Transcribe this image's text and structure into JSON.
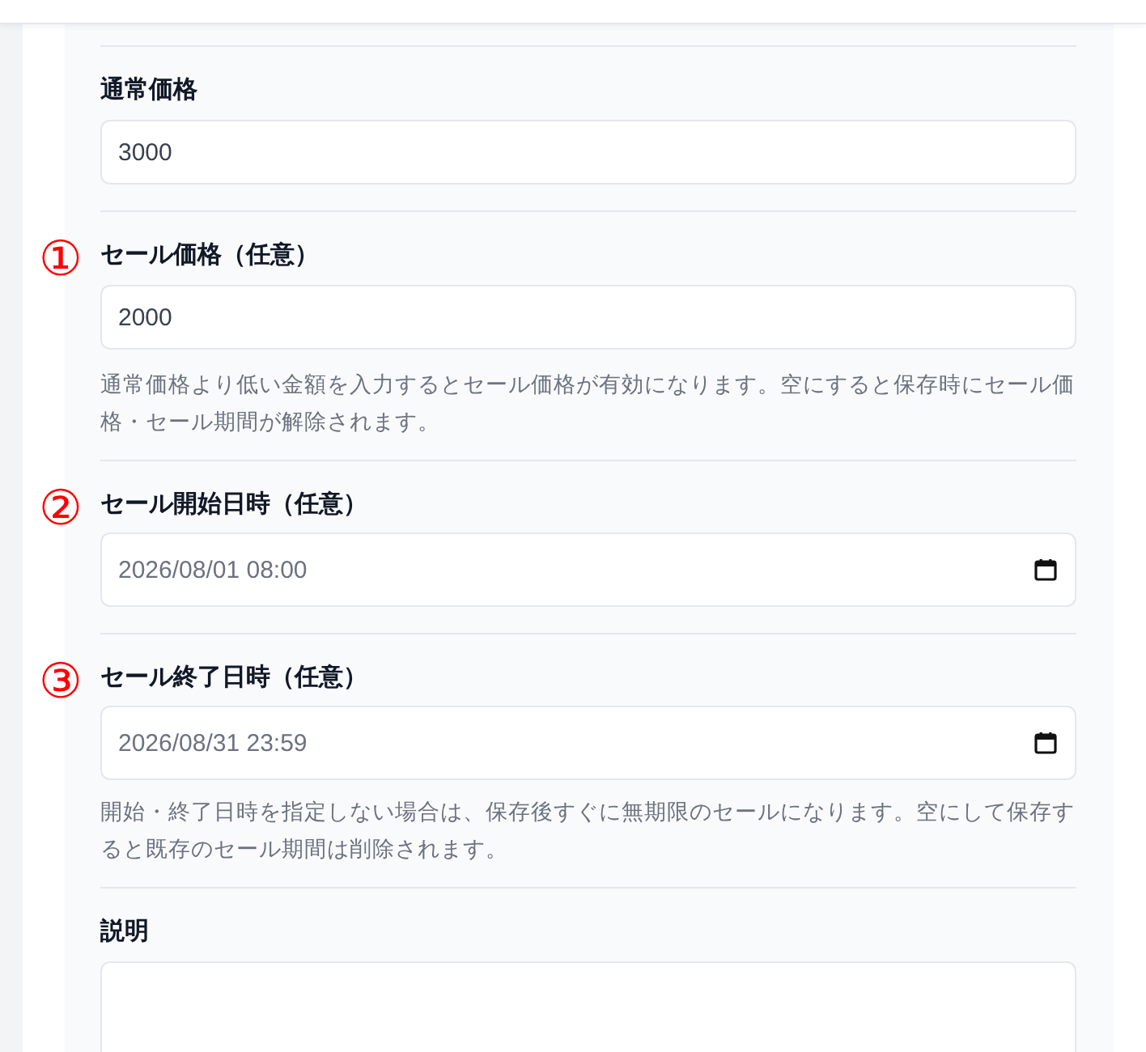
{
  "fields": [
    {
      "kind": "text",
      "label": "通常価格",
      "value": "3000"
    },
    {
      "kind": "text",
      "marker": "①",
      "label": "セール価格（任意）",
      "value": "2000",
      "help": "通常価格より低い金額を入力するとセール価格が有効になります。空にすると保存時にセール価格・セール期間が解除されます。"
    },
    {
      "kind": "datetime",
      "marker": "②",
      "label": "セール開始日時（任意）",
      "value": "2026/08/01 08:00"
    },
    {
      "kind": "datetime",
      "marker": "③",
      "label": "セール終了日時（任意）",
      "value": "2026/08/31 23:59",
      "help": "開始・終了日時を指定しない場合は、保存後すぐに無期限のセールになります。空にして保存すると既存のセール期間は削除されます。"
    },
    {
      "kind": "textarea",
      "label": "説明"
    }
  ]
}
